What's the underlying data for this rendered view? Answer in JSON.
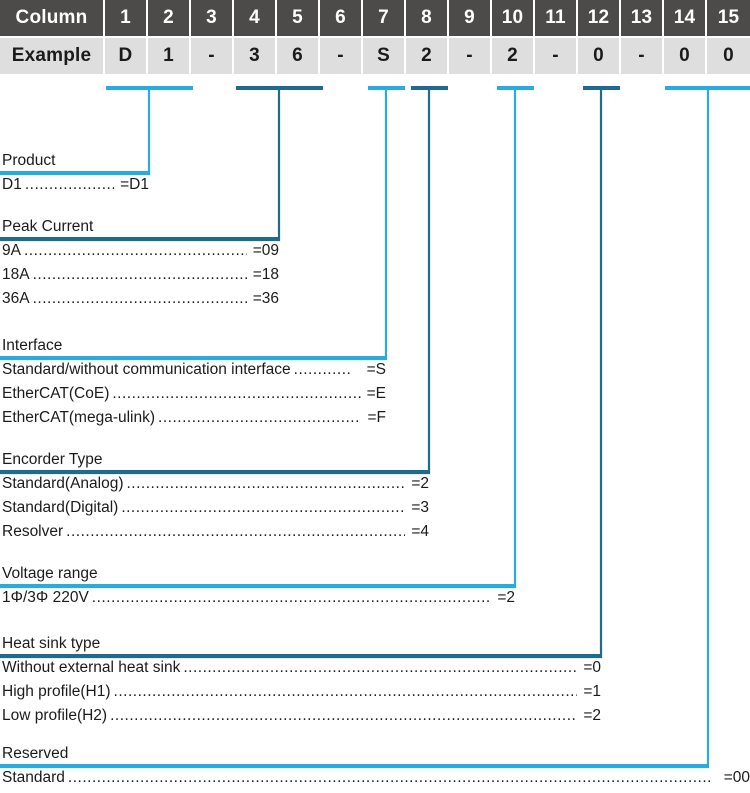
{
  "table": {
    "row_labels": {
      "column": "Column",
      "example": "Example"
    },
    "columns": [
      "1",
      "2",
      "3",
      "4",
      "5",
      "6",
      "7",
      "8",
      "9",
      "10",
      "11",
      "12",
      "13",
      "14",
      "15"
    ],
    "example": [
      "D",
      "1",
      "-",
      "3",
      "6",
      "-",
      "S",
      "2",
      "-",
      "2",
      "-",
      "0",
      "-",
      "0",
      "0"
    ]
  },
  "colors": {
    "header_bg": "#4d4a4a",
    "example_bg": "#dedede",
    "light_blue": "#29abe2",
    "dark_blue": "#1f6b8f",
    "text": "#1b1b1b"
  },
  "sections": [
    {
      "title": "Product",
      "accent": "light",
      "options": [
        {
          "name": "D1",
          "dots": "........................",
          "value": "=D1"
        }
      ]
    },
    {
      "title": "Peak Current",
      "accent": "dark",
      "options": [
        {
          "name": "9A",
          "dots": "..................................................",
          "value": "=09"
        },
        {
          "name": "18A",
          "dots": "..................................................",
          "value": "=18"
        },
        {
          "name": "36A",
          "dots": "..................................................",
          "value": "=36"
        }
      ]
    },
    {
      "title": "Interface",
      "accent": "light",
      "options": [
        {
          "name": "Standard/without communication interface",
          "dots": "............",
          "value": "=S"
        },
        {
          "name": "EtherCAT(CoE)",
          "dots": "......................................................",
          "value": "=E"
        },
        {
          "name": "EtherCAT(mega-ulink)",
          "dots": "............................................",
          "value": "=F"
        }
      ]
    },
    {
      "title": "Encorder Type",
      "accent": "dark",
      "options": [
        {
          "name": "Standard(Analog)",
          "dots": "..................................................................",
          "value": "=2"
        },
        {
          "name": "Standard(Digital)",
          "dots": "..................................................................",
          "value": "=3"
        },
        {
          "name": "Resolver",
          "dots": "..........................................................................",
          "value": "=4"
        }
      ]
    },
    {
      "title": "Voltage range",
      "accent": "light",
      "options": [
        {
          "name": "1Φ/3Φ 220V",
          "dots": "........................................................................................",
          "value": "=2"
        }
      ]
    },
    {
      "title": "Heat sink type",
      "accent": "dark",
      "options": [
        {
          "name": "Without external heat sink",
          "dots": "..................................................................................",
          "value": "=0"
        },
        {
          "name": "High profile(H1)",
          "dots": "..................................................................................................",
          "value": "=1"
        },
        {
          "name": "Low profile(H2)",
          "dots": "....................................................................................................",
          "value": "=2"
        }
      ]
    },
    {
      "title": "Reserved",
      "accent": "light",
      "options": [
        {
          "name": "Standard",
          "dots": "......................................................................................................................................",
          "value": "=00"
        }
      ]
    }
  ]
}
